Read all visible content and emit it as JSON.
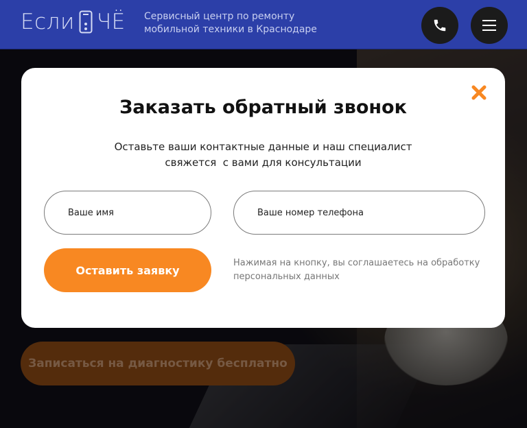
{
  "header": {
    "logo_left": "Если",
    "logo_right": "ЧЁ",
    "tagline_line1": "Сервисный центр по ремонту",
    "tagline_line2": "мобильной техники в Краснодаре",
    "phone_icon": "phone-icon",
    "menu_icon": "hamburger-menu-icon"
  },
  "hero": {
    "diagnostic_button": "Записаться на диагностику бесплатно"
  },
  "modal": {
    "title": "Заказать обратный звонок",
    "description_line1": "Оставьте ваши контактные данные и наш специалист",
    "description_line2": "свяжется  с вами для консультации",
    "name_placeholder": "Ваше имя",
    "phone_placeholder": "Ваше номер телефона",
    "submit_label": "Оставить заявку",
    "consent_text": "Нажимая на кнопку, вы соглашаетесь на обработку персональных данных",
    "close_icon": "close-icon"
  },
  "colors": {
    "header_bg": "#2c3fa8",
    "accent_orange": "#f88822",
    "close_color": "#f88822"
  }
}
